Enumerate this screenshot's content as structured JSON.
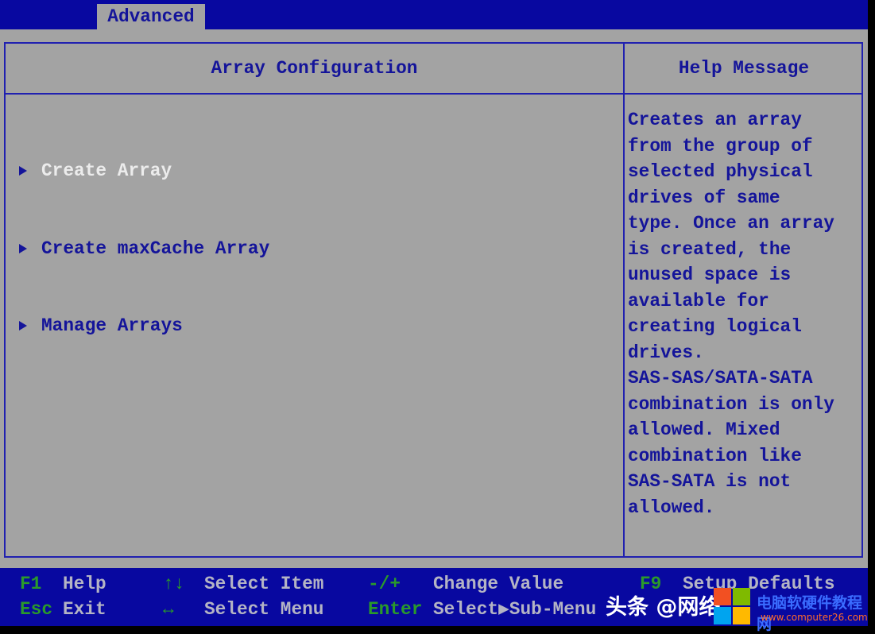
{
  "top_tab": "Advanced",
  "main": {
    "title": "Array Configuration",
    "items": [
      {
        "label": "Create Array",
        "selected": true
      },
      {
        "label": "Create maxCache Array",
        "selected": false
      },
      {
        "label": "Manage Arrays",
        "selected": false
      }
    ]
  },
  "help": {
    "title": "Help Message",
    "lines": [
      "Creates an array",
      "from the group of",
      "selected physical",
      "drives of same",
      "type. Once an array",
      "is created, the",
      "unused space is",
      "available for",
      "creating logical",
      "drives.",
      "SAS-SAS/SATA-SATA",
      "combination is only",
      "allowed. Mixed",
      "combination like",
      "SAS-SATA is not",
      "allowed."
    ]
  },
  "footer": {
    "row1": [
      {
        "key": "F1",
        "desc": "Help"
      },
      {
        "key": "↑↓",
        "desc": "Select Item"
      },
      {
        "key": "-/+",
        "desc": "Change Value"
      },
      {
        "key": "F9",
        "desc": "Setup Defaults"
      }
    ],
    "row2": [
      {
        "key": "Esc",
        "desc": "Exit"
      },
      {
        "key": "↔",
        "desc": "Select Menu"
      },
      {
        "key": "Enter",
        "desc": "Select▶Sub-Menu"
      }
    ]
  },
  "watermark": {
    "left": "头条 @网络",
    "brand": "电脑软硬件教程网",
    "url": "www.computer26.com"
  },
  "colors": {
    "bios_blue": "#0808a0",
    "panel_gray": "#a3a3a3",
    "text_blue": "#14149a",
    "key_green": "#2a9a2a",
    "selected_white": "#ececec"
  }
}
